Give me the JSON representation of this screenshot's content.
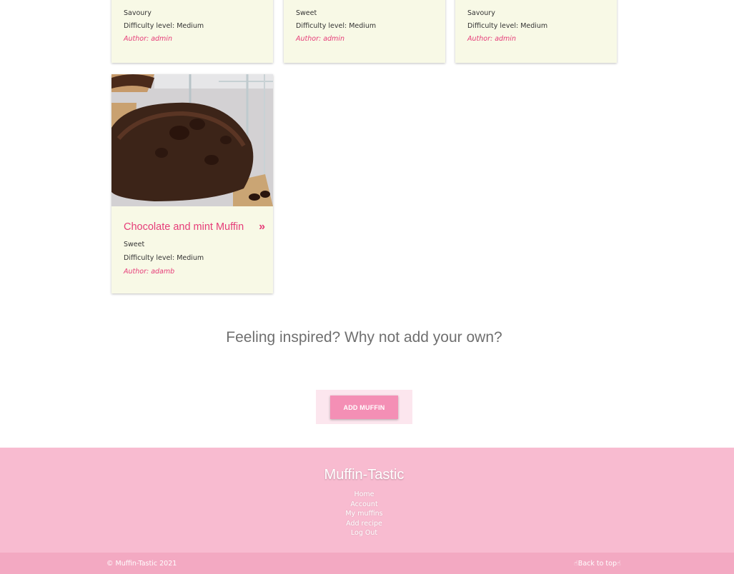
{
  "cards_top": [
    {
      "category": "Savoury",
      "difficulty": "Difficulty level: Medium",
      "author": "Author: admin"
    },
    {
      "category": "Sweet",
      "difficulty": "Difficulty level: Medium",
      "author": "Author: admin"
    },
    {
      "category": "Savoury",
      "difficulty": "Difficulty level: Medium",
      "author": "Author: admin"
    }
  ],
  "featured_card": {
    "title": "Chocolate and mint Muffin",
    "arrow": "»",
    "category": "Sweet",
    "difficulty": "Difficulty level: Medium",
    "author": "Author: adamb",
    "image": "chocolate-muffin-photo"
  },
  "inspire": {
    "heading": "Feeling inspired? Why not add your own?",
    "button": "ADD MUFFIN"
  },
  "footer": {
    "brand": "Muffin-Tastic",
    "links": [
      "Home",
      "Account",
      "My muffins",
      "Add recipe",
      "Log Out"
    ],
    "copyright": "© Muffin-Tastic 2021",
    "back_to_top": "Back to top",
    "back_to_top_icon": "pointing-hand-icon"
  },
  "colors": {
    "accent": "#e63c78",
    "button": "#f48fb5",
    "footer": "#f8bbd0",
    "footer_bottom": "#f3a9c2",
    "card": "#f8f9e6"
  }
}
